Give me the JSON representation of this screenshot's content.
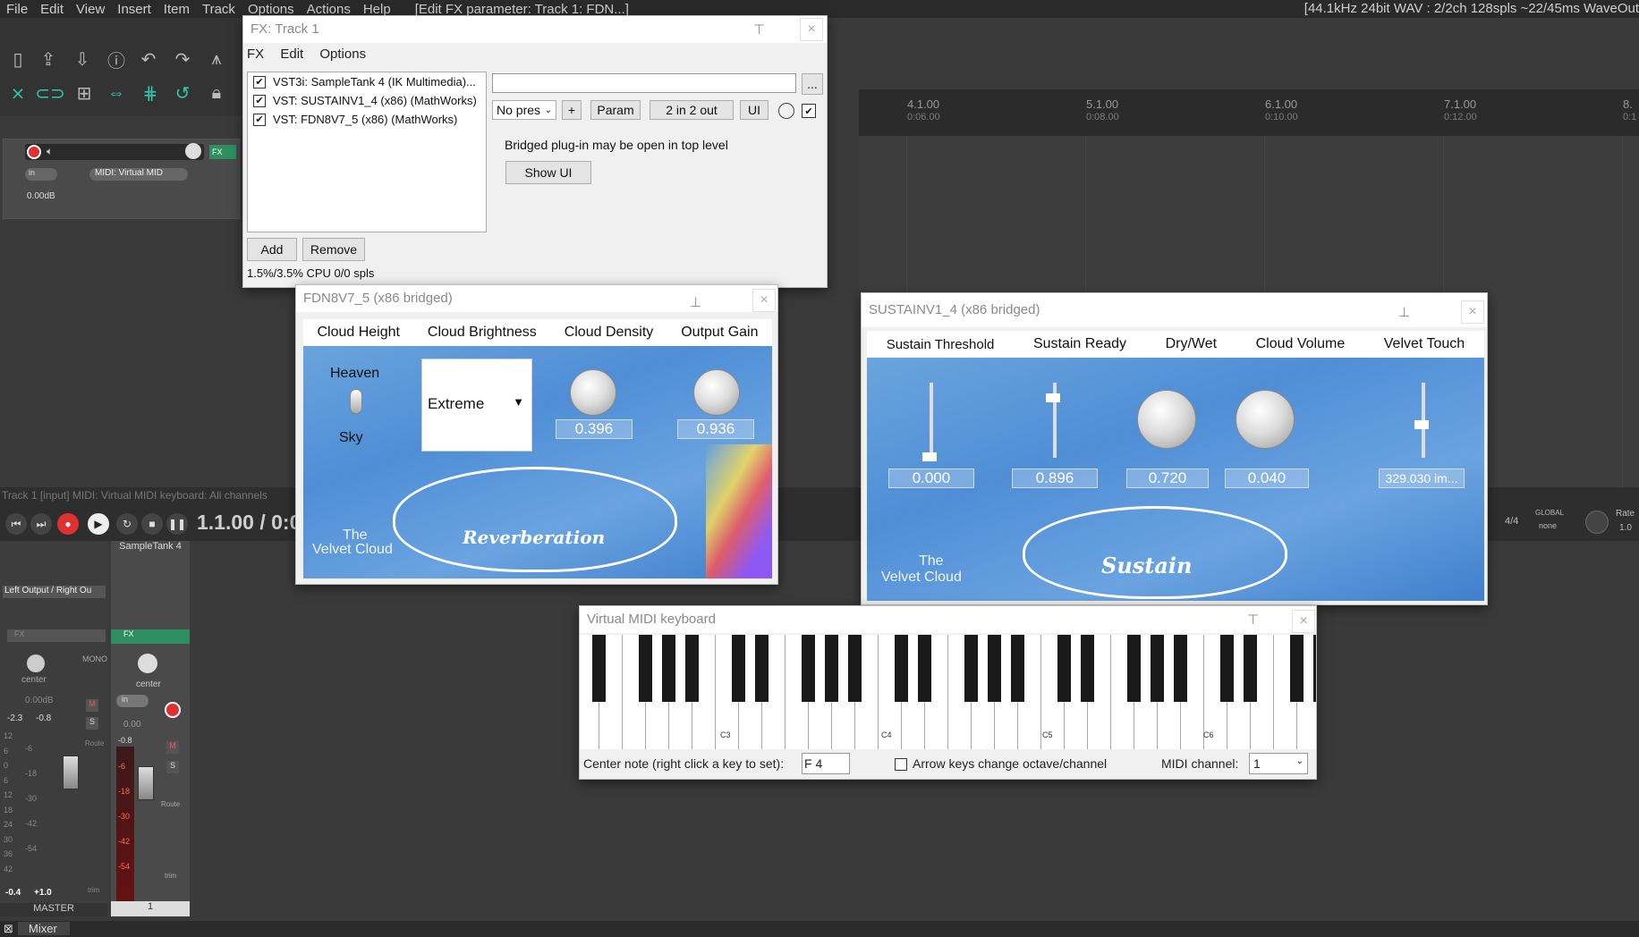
{
  "menubar": {
    "items": [
      "File",
      "Edit",
      "View",
      "Insert",
      "Item",
      "Track",
      "Options",
      "Actions",
      "Help"
    ],
    "window_title": "[Edit FX parameter: Track 1: FDN...]",
    "status": "[44.1kHz 24bit WAV : 2/2ch 128spls ~22/45ms WaveOut"
  },
  "ruler": {
    "marks": [
      {
        "bar": "4.1.00",
        "time": "0:06.00"
      },
      {
        "bar": "5.1.00",
        "time": "0:08.00"
      },
      {
        "bar": "6.1.00",
        "time": "0:10.00"
      },
      {
        "bar": "7.1.00",
        "time": "0:12.00"
      },
      {
        "bar": "8.",
        "time": "0:1"
      }
    ]
  },
  "track": {
    "number": "1",
    "fx_label": "FX",
    "in_label": "in",
    "input_label": "MIDI: Virtual MID",
    "volume": "0.00dB"
  },
  "trackinfo": "Track 1 [input] MIDI: Virtual MIDI keyboard: All channels",
  "transport": {
    "timecode": "1.1.00 / 0:0",
    "time_sig": "4/4",
    "global_label": "GLOBAL",
    "global_value": "none",
    "rate_label": "Rate",
    "rate_value": "1.0"
  },
  "mixer": {
    "master_label": "MASTER",
    "track_name": "SampleTank 4",
    "track_number": "1",
    "output": "Left Output / Right Ou",
    "fx_label": "FX",
    "center_label": "center",
    "mono_label": "MONO",
    "master_db": "0.00dB",
    "master_peak_l": "-2.3",
    "master_peak_r": "-0.8",
    "track_db": "0.00",
    "track_peak": "-0.8",
    "master_scale": [
      "12",
      "6",
      "0",
      "6",
      "12",
      "18",
      "24",
      "30",
      "36",
      "42"
    ],
    "master_scale_right": [
      "-6",
      "-18",
      "-30",
      "-42",
      "-54"
    ],
    "track_meter_marks": [
      "-6",
      "-18",
      "-30",
      "-42",
      "-54"
    ],
    "master_bottom_l": "-0.4",
    "master_bottom_r": "+1.0",
    "route_label": "Route",
    "trim_label": "trim",
    "m_label": "M",
    "s_label": "S",
    "in_label": "in"
  },
  "tabs": {
    "mixer": "Mixer"
  },
  "fx_window": {
    "title": "FX: Track 1",
    "menu": [
      "FX",
      "Edit",
      "Options"
    ],
    "plugins": [
      {
        "name": "VST3i: SampleTank 4 (IK Multimedia)...",
        "enabled": true
      },
      {
        "name": "VST: SUSTAINV1_4 (x86) (MathWorks)",
        "enabled": true
      },
      {
        "name": "VST: FDN8V7_5 (x86) (MathWorks)",
        "enabled": true
      }
    ],
    "preset_label": "No pres",
    "plus_label": "+",
    "param_label": "Param",
    "io_label": "2 in 2 out",
    "ui_label": "UI",
    "more_label": "...",
    "bridged_msg": "Bridged plug-in may be open in top level",
    "show_ui_label": "Show UI",
    "add_label": "Add",
    "remove_label": "Remove",
    "cpu": "1.5%/3.5% CPU 0/0 spls"
  },
  "fdn": {
    "title": "FDN8V7_5 (x86 bridged)",
    "params": [
      "Cloud Height",
      "Cloud Brightness",
      "Cloud Density",
      "Output Gain"
    ],
    "height_top": "Heaven",
    "height_bottom": "Sky",
    "brightness_value": "Extreme",
    "density_value": "0.396",
    "gain_value": "0.936",
    "brand": "The Velvet Cloud",
    "brand_line1": "The",
    "brand_line2": "Velvet Cloud",
    "cloud_text": "Reverberation"
  },
  "sustain": {
    "title": "SUSTAINV1_4 (x86 bridged)",
    "params": [
      "Sustain Threshold",
      "Sustain Ready",
      "Dry/Wet",
      "Cloud Volume",
      "Velvet Touch"
    ],
    "values": [
      "0.000",
      "0.896",
      "0.720",
      "0.040",
      "329.030 im..."
    ],
    "brand_line1": "The",
    "brand_line2": "Velvet Cloud",
    "cloud_text": "Sustain"
  },
  "keyboard": {
    "title": "Virtual MIDI keyboard",
    "octave_labels": [
      "C3",
      "C4",
      "C5",
      "C6"
    ],
    "center_note_label": "Center note (right click a key to set):",
    "center_note_value": "F 4",
    "arrow_keys_label": "Arrow keys change octave/channel",
    "midi_channel_label": "MIDI channel:",
    "midi_channel_value": "1"
  },
  "colors": {
    "accent_teal": "#2fc7a8",
    "record_red": "#e03030",
    "plugin_blue": "#4f8ed6"
  }
}
